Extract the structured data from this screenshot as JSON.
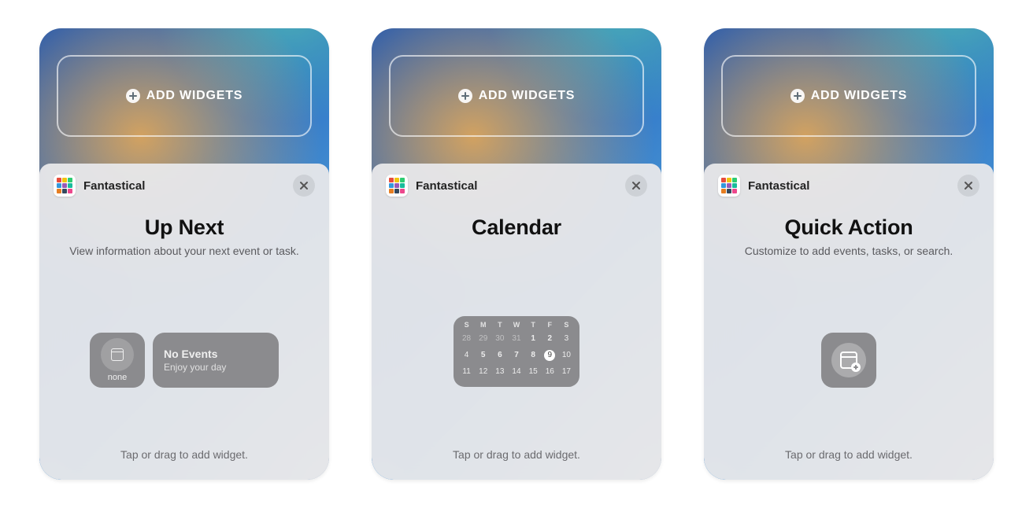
{
  "add_widgets_label": "ADD WIDGETS",
  "app_name": "Fantastical",
  "hint": "Tap or drag to add widget.",
  "panels": {
    "up_next": {
      "title": "Up Next",
      "subtitle": "View information about your next event or task.",
      "small_label": "none",
      "med_line1": "No Events",
      "med_line2": "Enjoy your day"
    },
    "calendar": {
      "title": "Calendar",
      "day_headers": [
        "S",
        "M",
        "T",
        "W",
        "T",
        "F",
        "S"
      ],
      "days": [
        {
          "n": "28",
          "mut": true
        },
        {
          "n": "29",
          "mut": true
        },
        {
          "n": "30",
          "mut": true
        },
        {
          "n": "31",
          "mut": true
        },
        {
          "n": "1",
          "bold": true
        },
        {
          "n": "2",
          "bold": true
        },
        {
          "n": "3"
        },
        {
          "n": "4"
        },
        {
          "n": "5",
          "bold": true
        },
        {
          "n": "6",
          "bold": true
        },
        {
          "n": "7",
          "bold": true
        },
        {
          "n": "8",
          "bold": true
        },
        {
          "n": "9",
          "sel": true
        },
        {
          "n": "10"
        },
        {
          "n": "11"
        },
        {
          "n": "12"
        },
        {
          "n": "13"
        },
        {
          "n": "14"
        },
        {
          "n": "15"
        },
        {
          "n": "16"
        },
        {
          "n": "17"
        }
      ]
    },
    "quick_action": {
      "title": "Quick Action",
      "subtitle": "Customize to add events, tasks, or search."
    }
  },
  "icon_colors": [
    "#e74c3c",
    "#f1c40f",
    "#2ecc71",
    "#3498db",
    "#9b59b6",
    "#1abc9c",
    "#e67e22",
    "#34495e",
    "#ec488d"
  ]
}
